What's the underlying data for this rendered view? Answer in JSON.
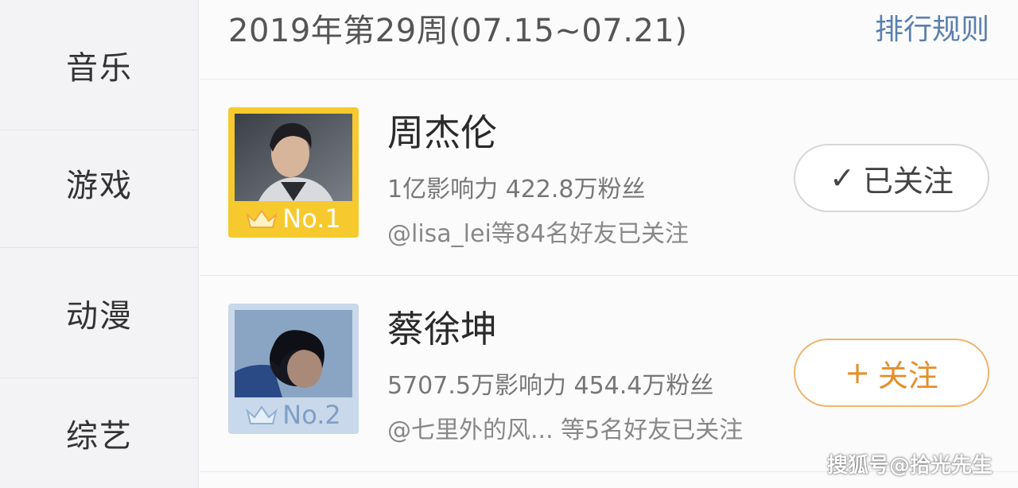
{
  "sidebar": {
    "items": [
      {
        "label": "音乐"
      },
      {
        "label": "游戏"
      },
      {
        "label": "动漫"
      },
      {
        "label": "综艺"
      }
    ]
  },
  "header": {
    "week_title": "2019年第29周(07.15~07.21)",
    "rules_link": "排行规则"
  },
  "ranking": [
    {
      "rank_label": "No.1",
      "name": "周杰伦",
      "stats": "1亿影响力 422.8万粉丝",
      "friends_text": "@lisa_lei等84名好友已关注",
      "follow_state": "followed",
      "follow_icon": "check-icon",
      "follow_label": "已关注",
      "frame_color": "#f6ca2e"
    },
    {
      "rank_label": "No.2",
      "name": "蔡徐坤",
      "stats": "5707.5万影响力 454.4万粉丝",
      "friends_text": "@七里外的风...  等5名好友已关注",
      "follow_state": "not-followed",
      "follow_icon": "plus-icon",
      "follow_label": "关注",
      "frame_color": "#c9d8ea"
    }
  ],
  "watermark": "搜狐号@拾光先生",
  "colors": {
    "accent_blue": "#5a7fae",
    "follow_orange": "#e48f2a",
    "gold": "#f6ca2e"
  }
}
